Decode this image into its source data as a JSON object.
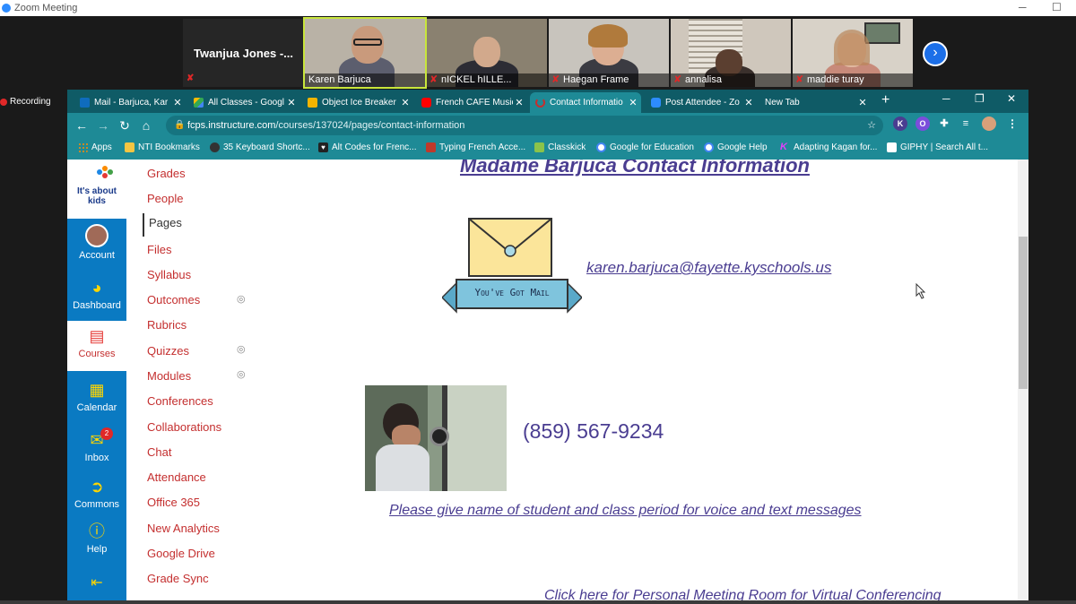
{
  "zoom": {
    "window_title": "Zoom Meeting",
    "recording_label": "Recording",
    "name_tile": "Twanjua Jones -...",
    "participants": [
      "Karen Barjuca",
      "nICKEL hILLE...",
      "Haegan Frame",
      "annalisa",
      "maddie turay"
    ]
  },
  "browser": {
    "tabs": [
      {
        "label": "Mail - Barjuca, Kar",
        "icon": "outlook-icon",
        "color": "#0f6cbd"
      },
      {
        "label": "All Classes - Googl",
        "icon": "google-drive-icon",
        "color": "#fbbc04"
      },
      {
        "label": "Object Ice Breaker",
        "icon": "google-slides-icon",
        "color": "#f4b400"
      },
      {
        "label": "French CAFE Music",
        "icon": "youtube-icon",
        "color": "#ff0000"
      },
      {
        "label": "Contact Informatio",
        "icon": "loading-icon",
        "color": "#c42f2f"
      },
      {
        "label": "Post Attendee - Zo",
        "icon": "zoom-icon",
        "color": "#2d8cff"
      },
      {
        "label": "New Tab",
        "icon": "",
        "color": ""
      }
    ],
    "url_host": "fcps.instructure.com",
    "url_path": "/courses/137024/pages/contact-information",
    "bookmarks": [
      {
        "label": "Apps",
        "icon": "apps-grid-icon",
        "color": "#ff8a00"
      },
      {
        "label": "NTI Bookmarks",
        "icon": "folder-icon",
        "color": "#f4c542"
      },
      {
        "label": "35 Keyboard Shortc...",
        "icon": "web-icon",
        "color": "#333333"
      },
      {
        "label": "Alt Codes for Frenc...",
        "icon": "heart-icon",
        "color": "#222222"
      },
      {
        "label": "Typing French Acce...",
        "icon": "bookmark-site-icon",
        "color": "#c0392b"
      },
      {
        "label": "Classkick",
        "icon": "classkick-icon",
        "color": "#8bc34a"
      },
      {
        "label": "Google for Education",
        "icon": "google-icon",
        "color": "#ffffff"
      },
      {
        "label": "Google Help",
        "icon": "google-icon",
        "color": "#ffffff"
      },
      {
        "label": "Adapting Kagan for...",
        "icon": "kagan-icon",
        "color": "#9c27b0"
      },
      {
        "label": "GIPHY | Search All t...",
        "icon": "document-icon",
        "color": "#ffffff"
      }
    ],
    "extensions": [
      {
        "label": "K",
        "color": "#4a3d91"
      },
      {
        "label": "O",
        "color": "#7b4ddb"
      }
    ]
  },
  "canvas": {
    "logo_text": "It's about kids",
    "rail": [
      {
        "label": "Account",
        "icon": "avatar-icon"
      },
      {
        "label": "Dashboard",
        "icon": "dashboard-icon"
      },
      {
        "label": "Courses",
        "icon": "courses-icon"
      },
      {
        "label": "Calendar",
        "icon": "calendar-icon"
      },
      {
        "label": "Inbox",
        "icon": "inbox-icon",
        "badge": "2"
      },
      {
        "label": "Commons",
        "icon": "commons-icon"
      },
      {
        "label": "Help",
        "icon": "help-icon"
      }
    ],
    "course_nav": [
      "Grades",
      "People",
      "Pages",
      "Files",
      "Syllabus",
      "Outcomes",
      "Rubrics",
      "Quizzes",
      "Modules",
      "Conferences",
      "Collaborations",
      "Chat",
      "Attendance",
      "Office 365",
      "New Analytics",
      "Google Drive",
      "Grade Sync"
    ],
    "active_nav": "Pages",
    "page": {
      "title": "Madame Barjuca Contact Information",
      "mail_banner": "You've Got Mail",
      "email": "karen.barjuca@fayette.kyschools.us",
      "phone": "(859) 567-9234",
      "note": "Please give name of student and class period for voice and text messages",
      "meeting_link": "Click here for  Personal Meeting Room for Virtual Conferencing"
    }
  },
  "colors": {
    "browser_frame": "#0f5b66",
    "toolbar": "#1e8a96",
    "canvas_rail": "#0a7ac2",
    "nav_link": "#c42f2f",
    "page_text": "#4a3d91"
  }
}
